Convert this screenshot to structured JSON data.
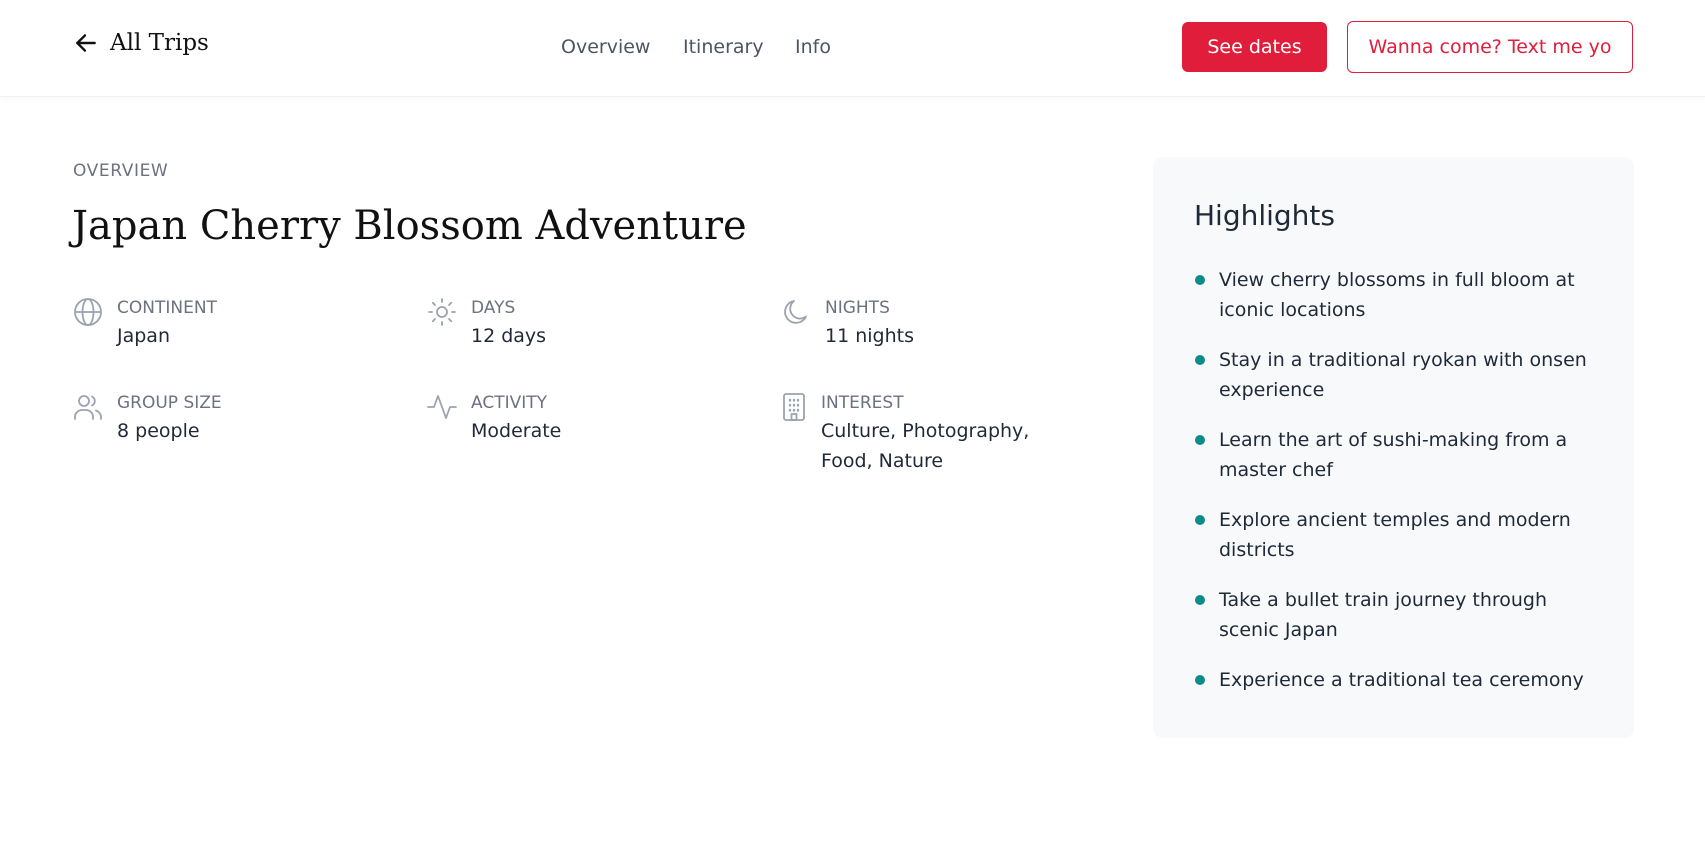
{
  "header": {
    "back_label": "All Trips",
    "nav": [
      {
        "label": "Overview"
      },
      {
        "label": "Itinerary"
      },
      {
        "label": "Info"
      }
    ],
    "primary_button": "See dates",
    "secondary_button": "Wanna come? Text me yo"
  },
  "overview": {
    "overline": "OVERVIEW",
    "title": "Japan Cherry Blossom Adventure",
    "stats": [
      {
        "icon": "globe-icon",
        "label": "CONTINENT",
        "value": "Japan"
      },
      {
        "icon": "sun-icon",
        "label": "DAYS",
        "value": "12 days"
      },
      {
        "icon": "moon-icon",
        "label": "NIGHTS",
        "value": "11 nights"
      },
      {
        "icon": "users-icon",
        "label": "GROUP SIZE",
        "value": "8 people"
      },
      {
        "icon": "activity-icon",
        "label": "ACTIVITY",
        "value": "Moderate"
      },
      {
        "icon": "building-icon",
        "label": "INTEREST",
        "value": "Culture, Photography, Food, Nature"
      }
    ]
  },
  "highlights": {
    "title": "Highlights",
    "items": [
      "View cherry blossoms in full bloom at iconic locations",
      "Stay in a traditional ryokan with onsen experience",
      "Learn the art of sushi-making from a master chef",
      "Explore ancient temples and modern districts",
      "Take a bullet train journey through scenic Japan",
      "Experience a traditional tea ceremony"
    ]
  },
  "colors": {
    "accent": "#e11d3c",
    "bullet": "#0f8a8a",
    "panel_bg": "#f8f9fb"
  }
}
